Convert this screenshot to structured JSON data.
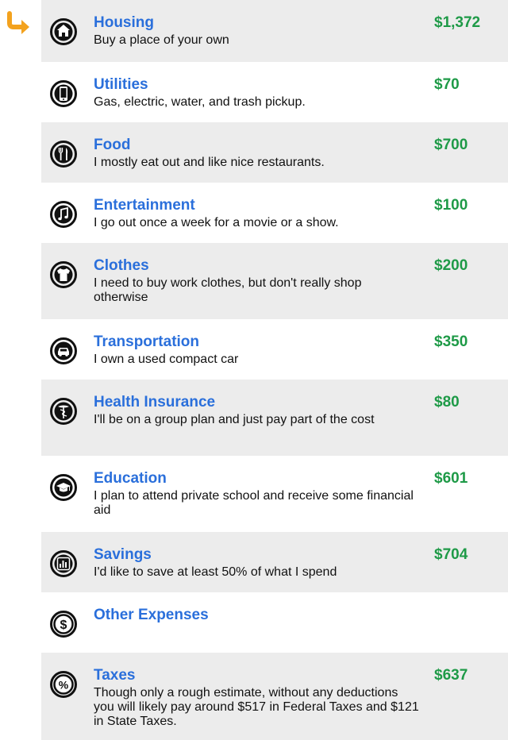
{
  "colors": {
    "title": "#2a6fdb",
    "amount": "#1e9a47",
    "arrow": "#f3a21e",
    "row_shade": "#ececec"
  },
  "items": [
    {
      "icon": "home-icon",
      "title": "Housing",
      "desc": "Buy a place of your own",
      "amount": "$1,372"
    },
    {
      "icon": "phone-icon",
      "title": "Utilities",
      "desc": "Gas, electric, water, and trash pickup.",
      "amount": "$70"
    },
    {
      "icon": "fork-knife-icon",
      "title": "Food",
      "desc": "I mostly eat out and like nice restaurants.",
      "amount": "$700"
    },
    {
      "icon": "music-note-icon",
      "title": "Entertainment",
      "desc": "I go out once a week for a movie or a show.",
      "amount": "$100"
    },
    {
      "icon": "shirt-icon",
      "title": "Clothes",
      "desc": "I need to buy work clothes, but don't really shop otherwise",
      "amount": "$200"
    },
    {
      "icon": "car-icon",
      "title": "Transportation",
      "desc": "I own a used compact car",
      "amount": "$350"
    },
    {
      "icon": "caduceus-icon",
      "title": "Health Insurance",
      "desc": "I'll be on a group plan and just pay part of the cost",
      "amount": "$80"
    },
    {
      "icon": "graduation-cap-icon",
      "title": "Education",
      "desc": "I plan to attend private school and receive some financial aid",
      "amount": "$601"
    },
    {
      "icon": "bar-chart-icon",
      "title": "Savings",
      "desc": "I'd like to save at least 50% of what I spend",
      "amount": "$704"
    },
    {
      "icon": "dollar-icon",
      "title": "Other Expenses",
      "desc": "",
      "amount": ""
    },
    {
      "icon": "percent-icon",
      "title": "Taxes",
      "desc": "Though only a rough estimate, without any deductions you will likely pay around $517 in Federal Taxes and $121 in State Taxes.",
      "amount": "$637"
    }
  ]
}
